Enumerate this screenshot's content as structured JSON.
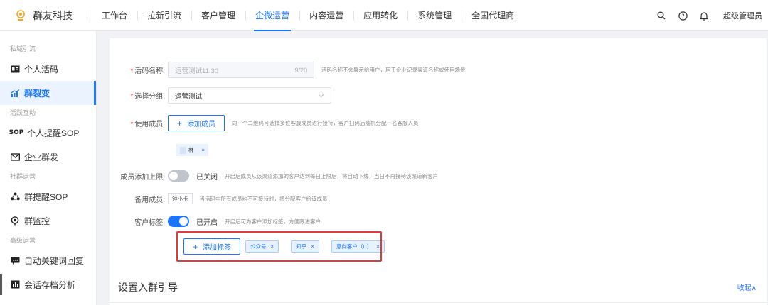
{
  "app": {
    "name": "群友科技"
  },
  "nav": [
    {
      "label": "工作台"
    },
    {
      "label": "拉新引流"
    },
    {
      "label": "客户管理"
    },
    {
      "label": "企微运营",
      "active": true
    },
    {
      "label": "内容运营"
    },
    {
      "label": "应用转化"
    },
    {
      "label": "系统管理"
    },
    {
      "label": "全国代理商"
    }
  ],
  "topright": {
    "user": "超级管理员",
    "icons": [
      "search-icon",
      "help-icon",
      "bell-icon"
    ]
  },
  "sidebar": {
    "groups": [
      {
        "title": "私域引流",
        "items": [
          {
            "label": "个人活码",
            "icon": "contact-card-icon"
          },
          {
            "label": "群裂变",
            "icon": "chart-growth-icon",
            "active": true
          }
        ]
      },
      {
        "title": "活跃互动",
        "items": [
          {
            "label": "个人提醒SOP",
            "icon": "sop-icon",
            "icon_text": "SOP"
          },
          {
            "label": "企业群发",
            "icon": "mail-send-icon"
          }
        ]
      },
      {
        "title": "社群运营",
        "items": [
          {
            "label": "群提醒SOP",
            "icon": "group-nodes-icon"
          },
          {
            "label": "群监控",
            "icon": "monitor-icon"
          }
        ]
      },
      {
        "title": "高级运营",
        "items": [
          {
            "label": "自动关键词回复",
            "icon": "chat-bubble-icon"
          },
          {
            "label": "会话存档分析",
            "icon": "analytics-icon"
          }
        ]
      }
    ]
  },
  "form": {
    "code_name": {
      "label": "活码名称:",
      "value": "运营测试11.30",
      "counter": "9/20",
      "hint": "活码名称不会展示给用户，用于企业记录渠道名称或使用场景"
    },
    "group": {
      "label": "选择分组:",
      "value": "运营测试"
    },
    "members": {
      "label": "使用成员:",
      "button": "添加成员",
      "hint": "同一个二维码可选择多位客服成员进行接待，客户扫码后随机分配一名客服人员",
      "chip": "林"
    },
    "limit": {
      "label": "成员添加上限:",
      "state": "已关闭",
      "on": false,
      "hint": "开启后成员从该渠道添加的客户达到每日上限后，将自动下线，当日不再接待该渠道新客户"
    },
    "backup": {
      "label": "备用成员:",
      "chip": "钟小卡",
      "hint": "当活码中所有成员均不可接待时，将分配客户给该成员"
    },
    "tags": {
      "label": "客户标签:",
      "state": "已开启",
      "on": true,
      "hint": "开启后可为客户添加标签，方便跟进客户",
      "button": "添加标签",
      "items": [
        "公众号",
        "知乎",
        "意向客户（C）"
      ]
    }
  },
  "section": {
    "title": "设置入群引导",
    "collapse": "收起∧"
  },
  "colors": {
    "accent": "#1a75ff",
    "highlight_box": "#e53935",
    "required": "#ff4d4f"
  }
}
